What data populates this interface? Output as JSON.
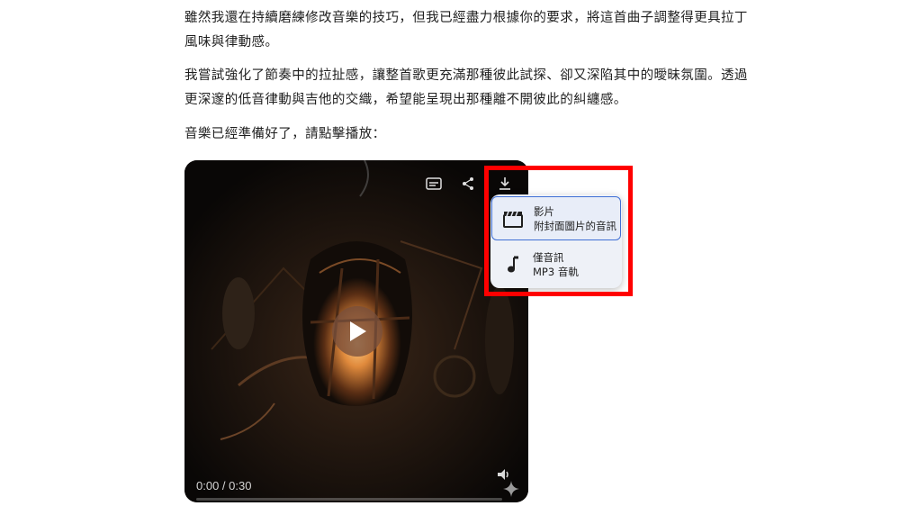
{
  "message": {
    "paragraph1": "雖然我還在持續磨練修改音樂的技巧，但我已經盡力根據你的要求，將這首曲子調整得更具拉丁風味與律動感。",
    "paragraph2": "我嘗試強化了節奏中的拉扯感，讓整首歌更充滿那種彼此試探、卻又深陷其中的曖昧氛圍。透過更深邃的低音律動與吉他的交織，希望能呈現出那種離不開彼此的糾纏感。",
    "paragraph3": "音樂已經準備好了，請點擊播放："
  },
  "player": {
    "time": "0:00 / 0:30",
    "progress": 0,
    "icons": [
      "captions-icon",
      "share-icon",
      "download-icon",
      "play-icon",
      "volume-icon",
      "sparkle-icon"
    ]
  },
  "download_menu": {
    "items": [
      {
        "title": "影片",
        "subtitle": "附封面圖片的音訊",
        "icon": "clapperboard-icon"
      },
      {
        "title": "僅音訊",
        "subtitle": "MP3 音軌",
        "icon": "music-note-icon"
      }
    ]
  },
  "colors": {
    "highlight": "#ff0000",
    "menu_selected_border": "#3f6fd4",
    "menu_background": "#eef1f7"
  }
}
